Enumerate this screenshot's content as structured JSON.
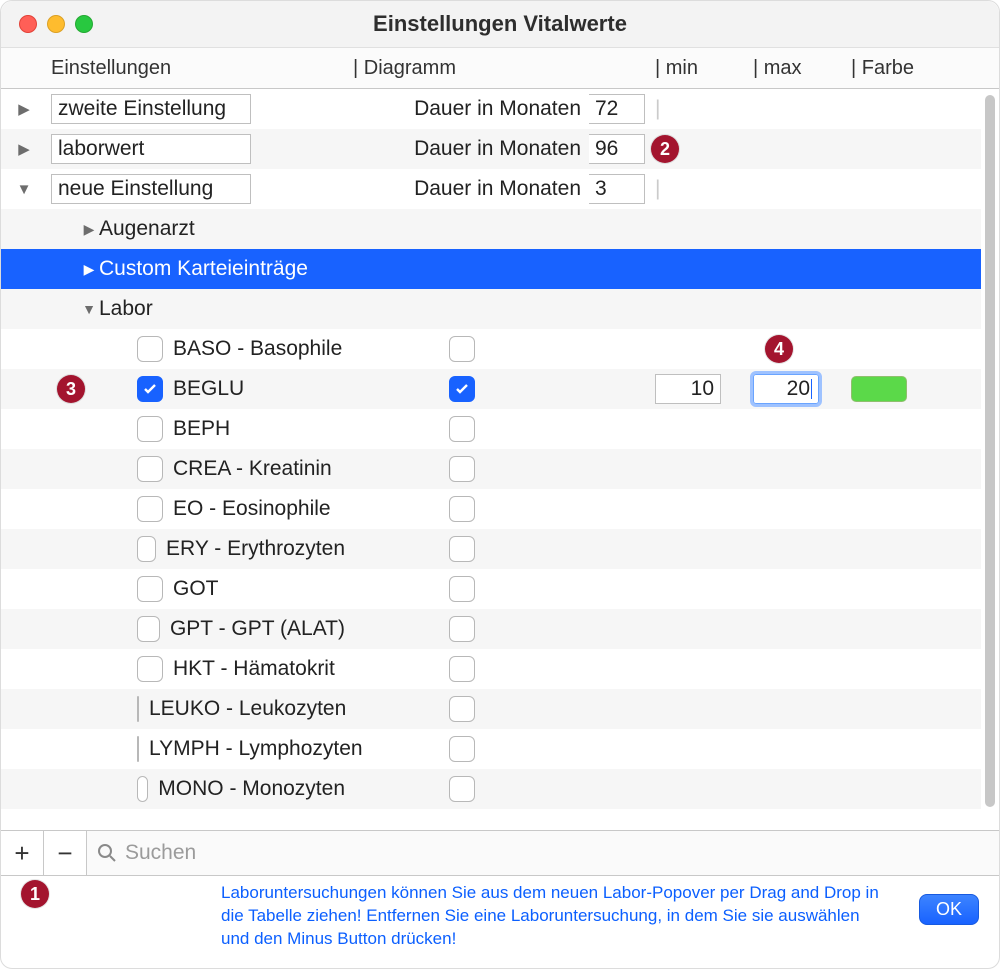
{
  "window": {
    "title": "Einstellungen Vitalwerte"
  },
  "columns": {
    "c1": "Einstellungen",
    "c2": "| Diagramm",
    "c3": "| min",
    "c4": "| max",
    "c5": "| Farbe"
  },
  "settings": [
    {
      "name": "zweite Einstellung",
      "duration_label": "Dauer in Monaten",
      "duration": "72",
      "expanded": false
    },
    {
      "name": "laborwert",
      "duration_label": "Dauer in Monaten",
      "duration": "96",
      "expanded": false
    },
    {
      "name": "neue Einstellung",
      "duration_label": "Dauer in Monaten",
      "duration": "3",
      "expanded": true
    }
  ],
  "groups": [
    {
      "label": "Augenarzt",
      "expanded": false,
      "selected": false
    },
    {
      "label": "Custom Karteieinträge",
      "expanded": false,
      "selected": true
    },
    {
      "label": "Labor",
      "expanded": true,
      "selected": false
    }
  ],
  "labor": [
    {
      "label": "BASO - Basophile",
      "checked": false,
      "diag": false
    },
    {
      "label": "BEGLU",
      "checked": true,
      "diag": true,
      "min": "10",
      "max": "20",
      "color": "#5bd949"
    },
    {
      "label": "BEPH",
      "checked": false,
      "diag": false
    },
    {
      "label": "CREA - Kreatinin",
      "checked": false,
      "diag": false
    },
    {
      "label": "EO - Eosinophile",
      "checked": false,
      "diag": false
    },
    {
      "label": "ERY - Erythrozyten",
      "checked": false,
      "diag": false
    },
    {
      "label": "GOT",
      "checked": false,
      "diag": false
    },
    {
      "label": "GPT - GPT (ALAT)",
      "checked": false,
      "diag": false
    },
    {
      "label": "HKT - Hämatokrit",
      "checked": false,
      "diag": false
    },
    {
      "label": "LEUKO - Leukozyten",
      "checked": false,
      "diag": false
    },
    {
      "label": "LYMPH - Lymphozyten",
      "checked": false,
      "diag": false
    },
    {
      "label": "MONO - Monozyten",
      "checked": false,
      "diag": false
    }
  ],
  "search_placeholder": "Suchen",
  "hint": "Laboruntersuchungen können Sie aus dem neuen Labor-Popover per Drag and Drop in die Tabelle ziehen! Entfernen Sie eine Laboruntersuchung, in dem Sie sie auswählen und den Minus Button drücken!",
  "ok_label": "OK",
  "annotations": {
    "b1": "1",
    "b2": "2",
    "b3": "3",
    "b4": "4"
  }
}
